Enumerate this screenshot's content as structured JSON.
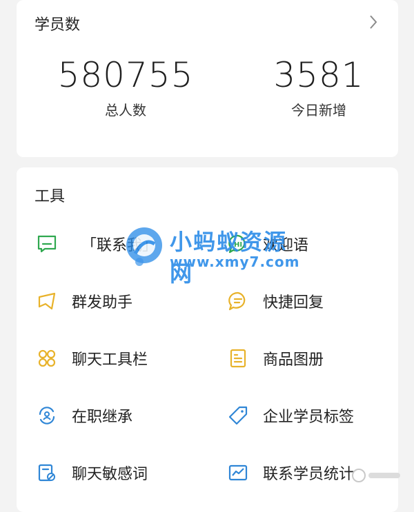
{
  "stats": {
    "title": "学员数",
    "total_value": "580755",
    "total_label": "总人数",
    "today_value": "3581",
    "today_label": "今日新增"
  },
  "tools": {
    "title": "工具",
    "items": [
      {
        "label": "「联系我」",
        "icon": "chat-square-icon",
        "color": "#2fa84f"
      },
      {
        "label": "欢迎语",
        "icon": "hi-bubble-icon",
        "color": "#2fa84f"
      },
      {
        "label": "群发助手",
        "icon": "megaphone-icon",
        "color": "#e8b22a"
      },
      {
        "label": "快捷回复",
        "icon": "quick-reply-icon",
        "color": "#e8b22a"
      },
      {
        "label": "聊天工具栏",
        "icon": "grid-flower-icon",
        "color": "#e8b22a"
      },
      {
        "label": "商品图册",
        "icon": "catalog-icon",
        "color": "#e8b22a"
      },
      {
        "label": "在职继承",
        "icon": "transfer-person-icon",
        "color": "#2f86d6"
      },
      {
        "label": "企业学员标签",
        "icon": "tag-icon",
        "color": "#2f86d6"
      },
      {
        "label": "聊天敏感词",
        "icon": "sensitive-word-icon",
        "color": "#2f86d6"
      },
      {
        "label": "联系学员统计",
        "icon": "stats-chart-icon",
        "color": "#2f86d6"
      }
    ]
  },
  "watermark": {
    "title": "小蚂蚁资源网",
    "url": "www.xmy7.com"
  }
}
